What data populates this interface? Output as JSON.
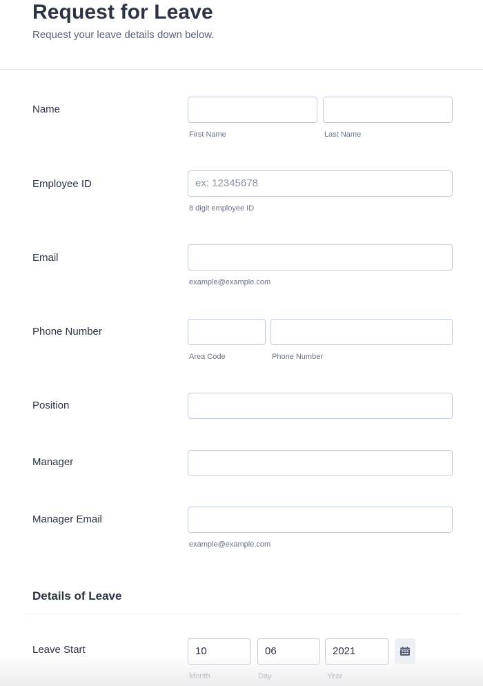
{
  "header": {
    "title": "Request for Leave",
    "subtitle": "Request your leave details down below."
  },
  "fields": {
    "name": {
      "label": "Name",
      "first": {
        "value": "",
        "sublabel": "First Name"
      },
      "last": {
        "value": "",
        "sublabel": "Last Name"
      }
    },
    "employee_id": {
      "label": "Employee ID",
      "value": "",
      "placeholder": "ex: 12345678",
      "sublabel": "8 digit employee ID"
    },
    "email": {
      "label": "Email",
      "value": "",
      "sublabel": "example@example.com"
    },
    "phone": {
      "label": "Phone Number",
      "area": {
        "value": "",
        "sublabel": "Area Code"
      },
      "number": {
        "value": "",
        "sublabel": "Phone Number"
      }
    },
    "position": {
      "label": "Position",
      "value": ""
    },
    "manager": {
      "label": "Manager",
      "value": ""
    },
    "manager_email": {
      "label": "Manager Email",
      "value": "",
      "sublabel": "example@example.com"
    }
  },
  "details_section": {
    "title": "Details of Leave",
    "leave_start": {
      "label": "Leave Start",
      "month": {
        "value": "10",
        "sublabel": "Month"
      },
      "day": {
        "value": "06",
        "sublabel": "Day"
      },
      "year": {
        "value": "2021",
        "sublabel": "Year"
      },
      "calendar_icon": "calendar-icon"
    }
  }
}
